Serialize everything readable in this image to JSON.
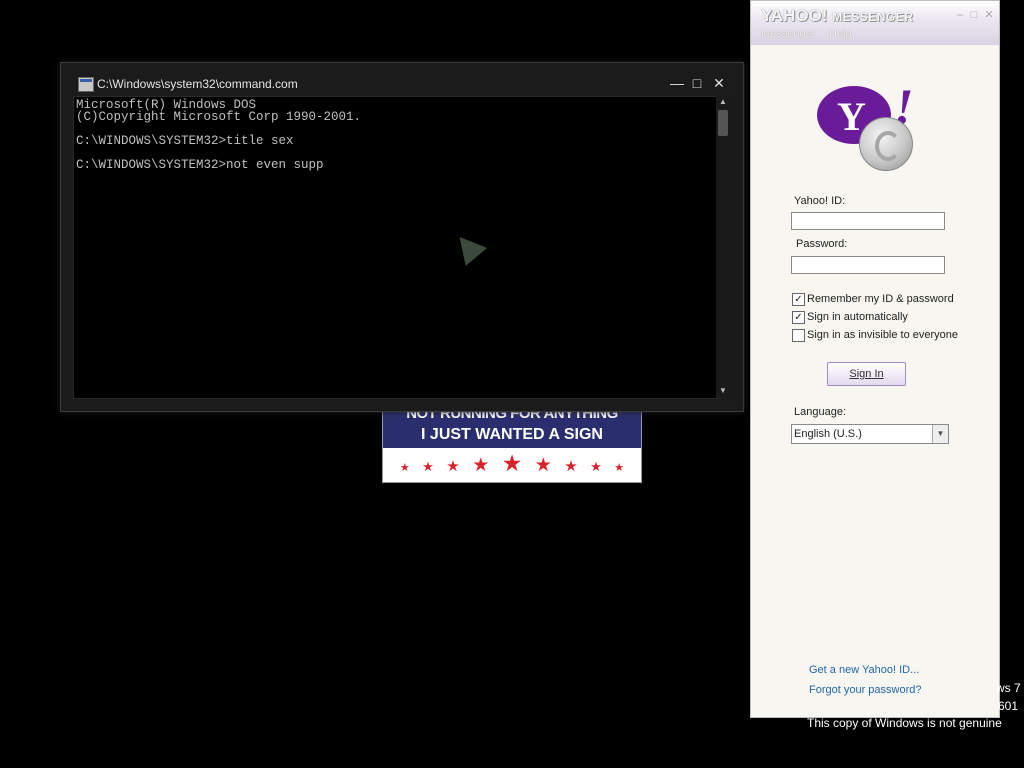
{
  "sign": {
    "line1": "NOT RUNNING FOR ANYTHING",
    "line2": "I JUST WANTED A SIGN",
    "stars": [
      "★",
      "★",
      "★",
      "★",
      "★",
      "★",
      "★",
      "★",
      "★"
    ]
  },
  "cmd": {
    "title": "C:\\Windows\\system32\\command.com",
    "minimize": "—",
    "maximize": "□",
    "close": "✕",
    "lines": "Microsoft(R) Windows DOS\n(C)Copyright Microsoft Corp 1990-2001.\n\nC:\\WINDOWS\\SYSTEM32>title sex\n\nC:\\WINDOWS\\SYSTEM32>not even supp"
  },
  "ym": {
    "logo_main": "YAHOO!",
    "logo_sub": "MESSENGER",
    "menu": [
      "Messenger",
      "Help"
    ],
    "ctrl": [
      "–",
      "□",
      "✕"
    ],
    "logo_letter": "Y",
    "logo_exclaim": "!",
    "id_label": "Yahoo! ID:",
    "password_label": "Password:",
    "checkboxes": [
      {
        "label": "Remember my ID & password",
        "checked": true
      },
      {
        "label": "Sign in automatically",
        "checked": true
      },
      {
        "label": "Sign in as invisible to everyone",
        "checked": false
      }
    ],
    "signin_button": "Sign In",
    "language_label": "Language:",
    "language_value": "English (U.S.)",
    "dropdown_arrow": "▼",
    "link_new_id": "Get a new Yahoo! ID...",
    "link_forgot": "Forgot your password?"
  },
  "watermark": {
    "line1": "ws 7",
    "line2": "601",
    "line3": "This copy of Windows is not genuine"
  }
}
